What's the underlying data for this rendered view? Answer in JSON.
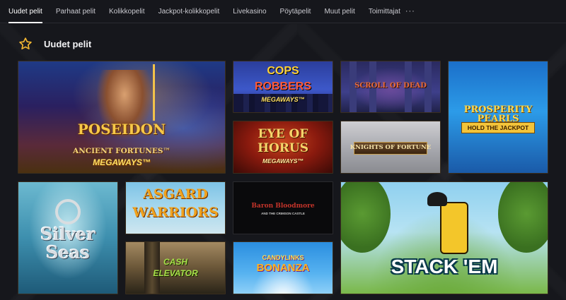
{
  "nav": {
    "items": [
      {
        "label": "Uudet pelit",
        "active": true
      },
      {
        "label": "Parhaat pelit",
        "active": false
      },
      {
        "label": "Kolikkopelit",
        "active": false
      },
      {
        "label": "Jackpot-kolikkopelit",
        "active": false
      },
      {
        "label": "Livekasino",
        "active": false
      },
      {
        "label": "Pöytäpelit",
        "active": false
      },
      {
        "label": "Muut pelit",
        "active": false
      },
      {
        "label": "Toimittajat",
        "active": false
      }
    ],
    "more_label": "···"
  },
  "section": {
    "icon": "star-icon",
    "title": "Uudet pelit"
  },
  "games": {
    "poseidon": {
      "line1": "POSEIDON",
      "line2": "ANCIENT FORTUNES™",
      "line3": "MEGAWAYS™"
    },
    "cops": {
      "line1": "COPS",
      "line2": "ROBBERS",
      "line3": "MEGAWAYS™"
    },
    "scroll": {
      "line1": "SCROLL OF DEAD"
    },
    "pearls": {
      "line1": "PROSPERITY PEARLS",
      "line2": "HOLD THE JACKPOT"
    },
    "horus": {
      "line1": "EYE OF",
      "line2": "HORUS",
      "line3": "MEGAWAYS™"
    },
    "knights": {
      "line1": "KNIGHTS OF FORTUNE"
    },
    "silver": {
      "line1": "Silver",
      "line2": "Seas"
    },
    "asgard": {
      "line1": "ASGARD",
      "line2": "WARRIORS"
    },
    "baron": {
      "line1": "Baron Bloodmore",
      "line2": "AND THE CRIMSON CASTLE"
    },
    "stack": {
      "line1": "STACK 'EM"
    },
    "cash": {
      "line1": "CASH",
      "line2": "ELEVATOR"
    },
    "candy": {
      "line1": "CANDYLINKS",
      "line2": "BONANZA"
    }
  }
}
